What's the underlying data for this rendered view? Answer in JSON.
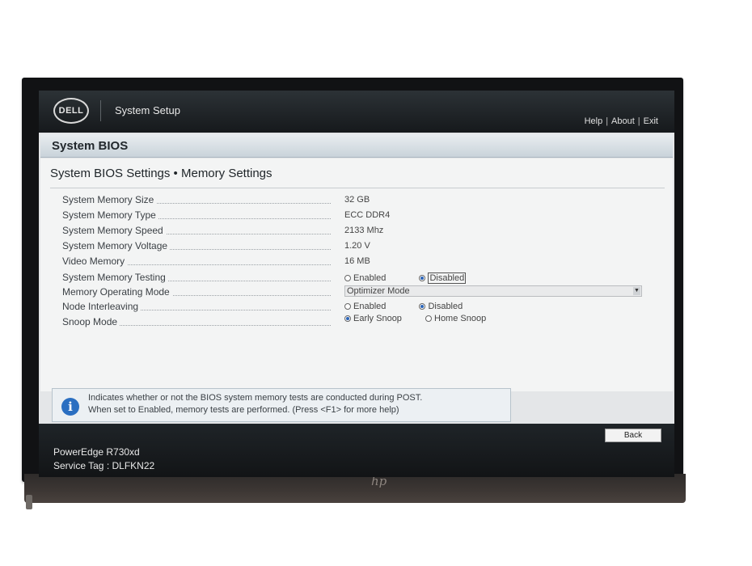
{
  "header": {
    "app_title": "System Setup",
    "logo_text": "DELL",
    "links": [
      "Help",
      "About",
      "Exit"
    ],
    "link_separator": "|"
  },
  "section": {
    "title": "System BIOS"
  },
  "page": {
    "title": "System BIOS Settings • Memory Settings"
  },
  "settings": [
    {
      "label": "System Memory Size",
      "value": "32 GB"
    },
    {
      "label": "System Memory Type",
      "value": "ECC DDR4"
    },
    {
      "label": "System Memory Speed",
      "value": "2133 Mhz"
    },
    {
      "label": "System Memory Voltage",
      "value": "1.20 V"
    },
    {
      "label": "Video Memory",
      "value": "16 MB"
    },
    {
      "label": "System Memory Testing",
      "options": [
        "Enabled",
        "Disabled"
      ],
      "selected": "Disabled"
    },
    {
      "label": "Memory Operating Mode",
      "value": "Optimizer Mode"
    },
    {
      "label": "Node Interleaving",
      "options": [
        "Enabled",
        "Disabled"
      ],
      "selected": "Disabled"
    },
    {
      "label": "Snoop Mode",
      "options": [
        "Early Snoop",
        "Home Snoop"
      ],
      "selected": "Early Snoop"
    }
  ],
  "help": {
    "line1": "Indicates whether or not the BIOS system memory tests are conducted during POST.",
    "line2": "When set to Enabled, memory tests are performed. (Press <F1> for more help)",
    "icon": "info-icon"
  },
  "footer": {
    "back_label": "Back",
    "model": "PowerEdge R730xd",
    "service_tag": "Service Tag : DLFKN22"
  },
  "monitor": {
    "brand": "hp"
  },
  "colors": {
    "accent": "#2b6fc1",
    "bar": "#16191c"
  }
}
